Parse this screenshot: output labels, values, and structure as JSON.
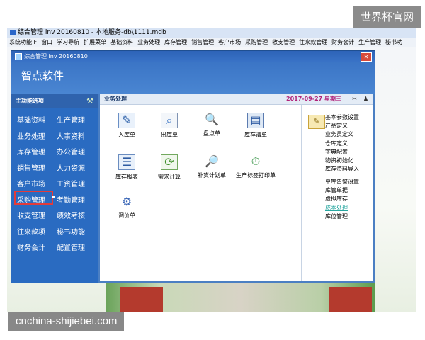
{
  "watermark": {
    "top": "世界杯官网",
    "bottom": "cnchina-shijiebei.com"
  },
  "outer": {
    "title": "综合管理 inv 20160810 - 本地服务-db\\1111.mdb",
    "menu": [
      "系统功能 F",
      "窗口",
      "学习导航",
      "扩展菜单",
      "基础资料",
      "业务处理",
      "库存管理",
      "销售管理",
      "客户市场",
      "采购管理",
      "收支管理",
      "往来款管理",
      "财务会计",
      "生产管理",
      "秘书功"
    ]
  },
  "window": {
    "title": "综合管理 inv 20160810",
    "brand": "智点软件",
    "close_icon": "close-icon"
  },
  "left_panel": {
    "header": "主功能选项",
    "tool_icon": "wrench-icon",
    "col1": [
      "基础资料",
      "业务处理",
      "库存管理",
      "销售管理",
      "客户市场",
      "采购管理",
      "收支管理",
      "往来款项",
      "财务会计"
    ],
    "col2": [
      "生产管理",
      "人事资料",
      "办公管理",
      "人力资源",
      "工资管理",
      "考勤管理",
      "绩效考核",
      "秘书功能",
      "配置管理"
    ],
    "selected": "库存管理"
  },
  "content": {
    "section_title": "业务处理",
    "date_text": "2017-09-27 星期三",
    "icons": [
      {
        "label": "入库单",
        "icon": "stock-in-icon"
      },
      {
        "label": "出库单",
        "icon": "stock-out-icon"
      },
      {
        "label": "盘点单",
        "icon": "inventory-count-icon"
      },
      {
        "label": "库存清单",
        "icon": "stock-list-icon"
      },
      {
        "label": "库存报表",
        "icon": "stock-report-icon"
      },
      {
        "label": "需求计算",
        "icon": "demand-calc-icon"
      },
      {
        "label": "补货计划单",
        "icon": "replenish-plan-icon"
      },
      {
        "label": "生产标签打印单",
        "icon": "label-print-icon"
      },
      {
        "label": "调价单",
        "icon": "price-adjust-icon"
      }
    ],
    "right_links": [
      "基本参数设置",
      "产品定义",
      "业务员定义",
      "仓库定义",
      "字典配置",
      "物资初始化",
      "库存资料导入",
      "单库告警设置",
      "库管单据",
      "虚拟库存",
      "成本处理",
      "库位管理"
    ],
    "highlighted_link": "成本处理"
  }
}
